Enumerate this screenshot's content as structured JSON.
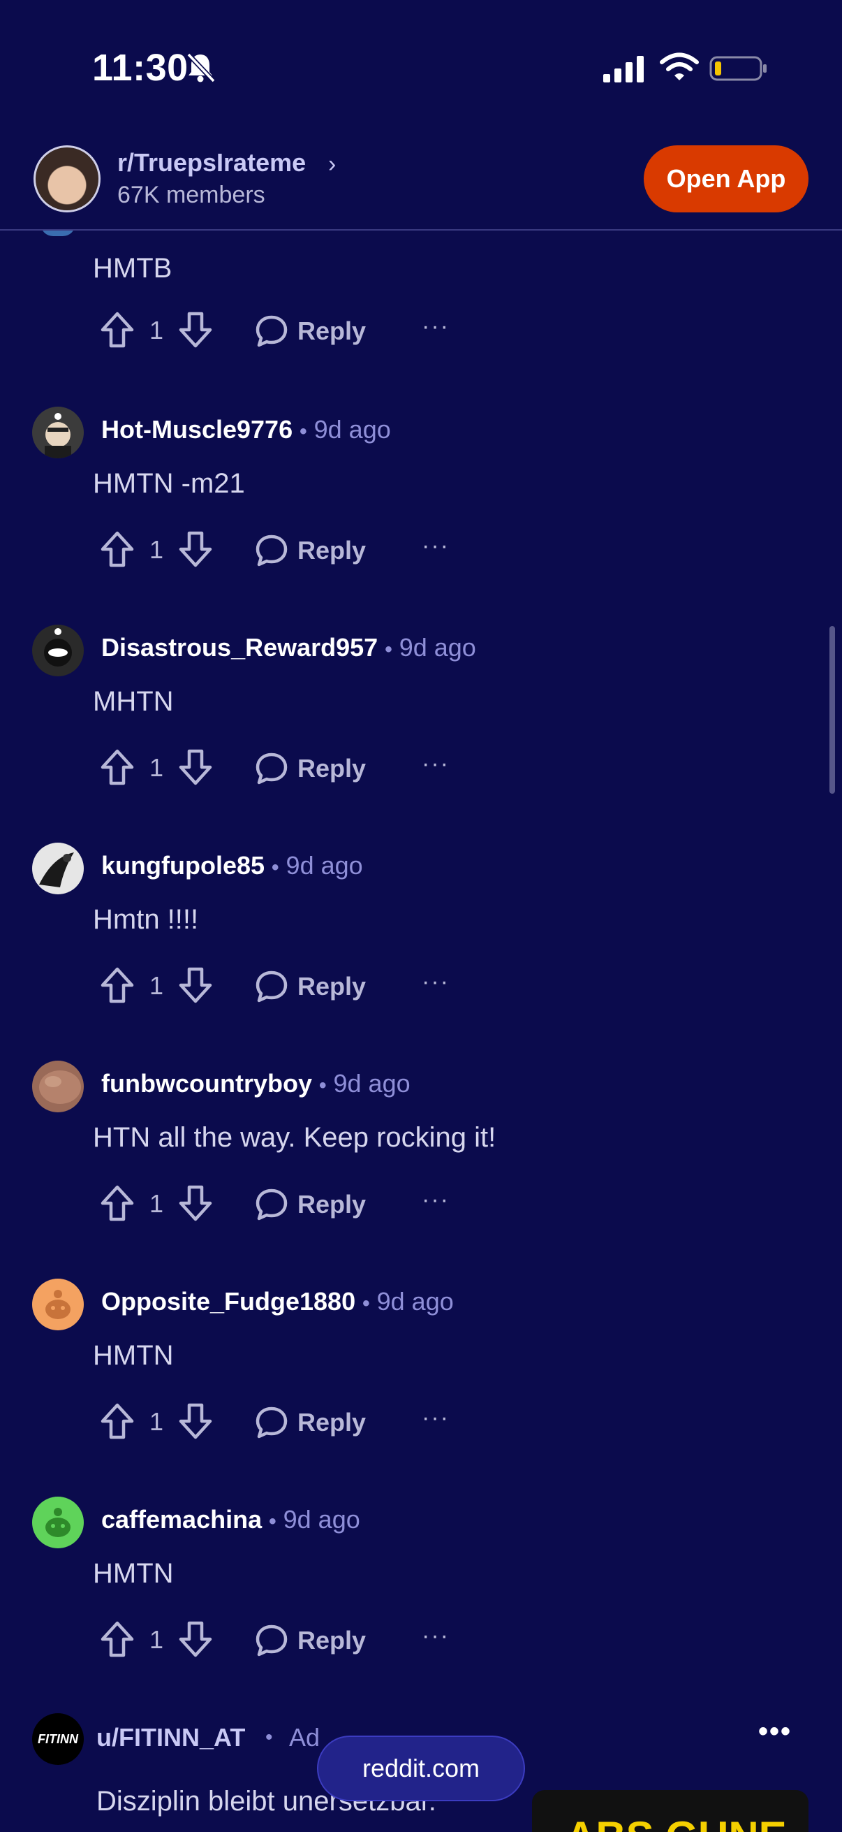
{
  "status_bar": {
    "time": "11:30"
  },
  "subreddit": {
    "name": "r/TruepsIrateme",
    "members": "67K members",
    "open_app_label": "Open App"
  },
  "partial_comment": {
    "body": "HMTB",
    "votes": "1",
    "reply_label": "Reply",
    "more": "···"
  },
  "comments": [
    {
      "author": "Hot-Muscle9776",
      "time": "9d ago",
      "body": "HMTN -m21",
      "votes": "1",
      "reply_label": "Reply",
      "more": "···",
      "avatar_color": "#2e2e2e"
    },
    {
      "author": "Disastrous_Reward957",
      "time": "9d ago",
      "body": "MHTN",
      "votes": "1",
      "reply_label": "Reply",
      "more": "···",
      "avatar_color": "#3a3a3a"
    },
    {
      "author": "kungfupole85",
      "time": "9d ago",
      "body": "Hmtn !!!!",
      "votes": "1",
      "reply_label": "Reply",
      "more": "···",
      "avatar_color": "#e6e6e6"
    },
    {
      "author": "funbwcountryboy",
      "time": "9d ago",
      "body": "HTN all the way. Keep rocking it!",
      "votes": "1",
      "reply_label": "Reply",
      "more": "···",
      "avatar_color": "#9a6a58"
    },
    {
      "author": "Opposite_Fudge1880",
      "time": "9d ago",
      "body": "HMTN",
      "votes": "1",
      "reply_label": "Reply",
      "more": "···",
      "avatar_color": "#f4a261"
    },
    {
      "author": "caffemachina",
      "time": "9d ago",
      "body": "HMTN",
      "votes": "1",
      "reply_label": "Reply",
      "more": "···",
      "avatar_color": "#5fd35a"
    }
  ],
  "ad": {
    "logo_text": "FITINN",
    "author": "u/FITINN_AT",
    "tag": "Ad",
    "more": "•••",
    "text": "Disziplin bleibt unersetzbar.",
    "image_text": "ABS GUNE"
  },
  "domain_pill": "reddit.com",
  "colors": {
    "background": "#0b0b4d",
    "accent_button": "#d93a00",
    "timestamp": "#8f8fd8"
  }
}
